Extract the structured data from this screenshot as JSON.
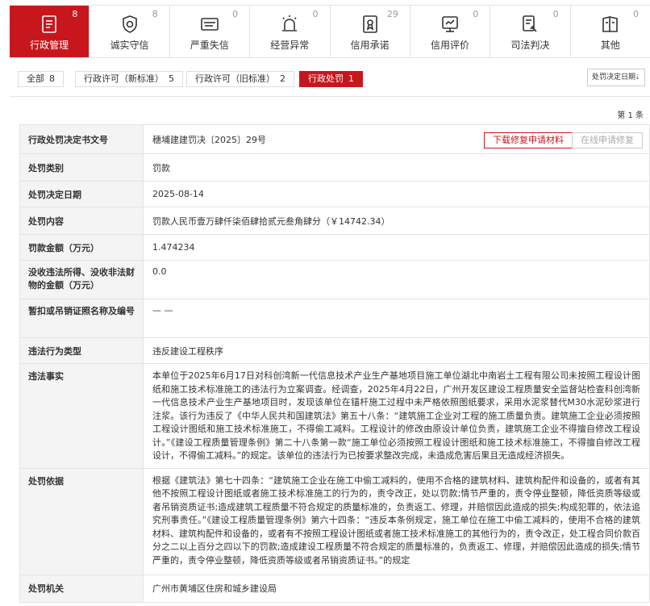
{
  "categories": [
    {
      "label": "行政管理",
      "count": "8",
      "icon": "document-icon",
      "active": true
    },
    {
      "label": "诚实守信",
      "count": "8",
      "icon": "shield-icon",
      "active": false
    },
    {
      "label": "严重失信",
      "count": "0",
      "icon": "ticket-icon",
      "active": false
    },
    {
      "label": "经营异常",
      "count": "0",
      "icon": "alarm-icon",
      "active": false
    },
    {
      "label": "信用承诺",
      "count": "29",
      "icon": "certificate-icon",
      "active": false
    },
    {
      "label": "信用评价",
      "count": "0",
      "icon": "rating-icon",
      "active": false
    },
    {
      "label": "司法判决",
      "count": "0",
      "icon": "judgment-icon",
      "active": false
    },
    {
      "label": "其他",
      "count": "0",
      "icon": "book-icon",
      "active": false
    }
  ],
  "filters": [
    {
      "label": "全部",
      "count": "8"
    },
    {
      "label": "行政许可（新标准）",
      "count": "5"
    },
    {
      "label": "行政许可（旧标准）",
      "count": "2"
    },
    {
      "label": "行政处罚",
      "count": "1"
    }
  ],
  "sort": {
    "label": "处罚决定日期",
    "caret": "⇣"
  },
  "page_info": "第 1 条",
  "actions": {
    "download": "下载修复申请材料",
    "online": "在线申请修复"
  },
  "rows": [
    {
      "key": "行政处罚决定书文号",
      "value": "穗埔建建罚决〔2025〕29号"
    },
    {
      "key": "处罚类别",
      "value": "罚款"
    },
    {
      "key": "处罚决定日期",
      "value": "2025-08-14"
    },
    {
      "key": "处罚内容",
      "value": "罚款人民币壹万肆仟柒佰肆拾贰元叁角肆分（￥14742.34）"
    },
    {
      "key": "罚款金额（万元）",
      "value": "1.474234"
    },
    {
      "key": "没收违法所得、没收非法财物的金额（万元）",
      "value": "0.0"
    },
    {
      "key": "暂扣或吊销证照名称及编号",
      "value": "— —"
    },
    {
      "key": "违法行为类型",
      "value": "违反建设工程秩序"
    },
    {
      "key": "违法事实",
      "value": "本单位于2025年6月17日对科创湾新一代信息技术产业生产基地项目施工单位湖北中南岩土工程有限公司未按照工程设计图纸和施工技术标准施工的违法行为立案调查。经调查，2025年4月22日，广州开发区建设工程质量安全监督站检查科创湾新一代信息技术产业生产基地项目时，发现该单位在锚杆施工过程中未严格依照图纸要求，采用水泥浆替代M30水泥砂浆进行注浆。该行为违反了《中华人民共和国建筑法》第五十八条：“建筑施工企业对工程的施工质量负责。建筑施工企业必须按照工程设计图纸和施工技术标准施工，不得偷工减料。工程设计的修改由原设计单位负责，建筑施工企业不得擅自修改工程设计。”《建设工程质量管理条例》第二十八条第一款“施工单位必须按照工程设计图纸和施工技术标准施工，不得擅自修改工程设计，不得偷工减料。”的规定。该单位的违法行为已按要求整改完成，未造成危害后果且无造成经济损失。"
    },
    {
      "key": "处罚依据",
      "value": "根据《建筑法》第七十四条：“建筑施工企业在施工中偷工减料的，使用不合格的建筑材料、建筑构配件和设备的，或者有其他不按照工程设计图纸或者施工技术标准施工的行为的，责令改正，处以罚款;情节严重的，责令停业整顿，降低资质等级或者吊销资质证书;造成建筑工程质量不符合规定的质量标准的，负责返工、修理，并赔偿因此造成的损失;构成犯罪的，依法追究刑事责任。”《建设工程质量管理条例》第六十四条：“违反本条例规定，施工单位在施工中偷工减料的，使用不合格的建筑材料、建筑构配件和设备的，或者有不按照工程设计图纸或者施工技术标准施工的其他行为的，责令改正，处工程合同价款百分之二以上百分之四以下的罚款;造成建设工程质量不符合规定的质量标准的，负责返工、修理，并赔偿因此造成的损失;情节严重的，责令停业整顿，降低资质等级或者吊销资质证书。”的规定"
    },
    {
      "key": "处罚机关",
      "value": "广州市黄埔区住房和城乡建设局"
    }
  ]
}
